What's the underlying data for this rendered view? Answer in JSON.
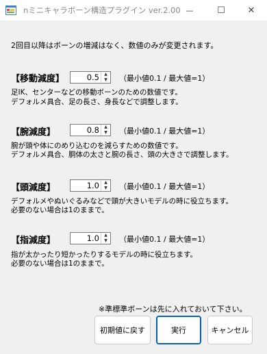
{
  "window": {
    "title": "nミニキャラボーン構造プラグイン ver.2.00",
    "minimize_glyph": "—",
    "maximize_glyph": "☐",
    "close_glyph": "✕"
  },
  "intro_text": "2回目以降はボーンの増減はなく、数値のみが変更されます。",
  "sections": [
    {
      "label": "【移動減度】",
      "value": "0.5",
      "range": "（最小値0.1 / 最大値=1）",
      "desc_line1": "足IK、センターなどの移動ボーンのための数値です。",
      "desc_line2": "デフォルメ具合、足の長さ、身長などで調整します。"
    },
    {
      "label": "【腕減度】",
      "value": "0.8",
      "range": "（最小値0.1 / 最大値=1）",
      "desc_line1": "腕が頭や体にのめり込むのを減らすための数値です。",
      "desc_line2": "デフォルメ具合、胴体の太さと腕の長さ、頭の大きさで調整します。"
    },
    {
      "label": "【頭減度】",
      "value": "1.0",
      "range": "（最小値0.1 / 最大値=1）",
      "desc_line1": "デフォルメやぬいぐるみなどで頭が大きいモデルの時に役立ちます。",
      "desc_line2": "必要のない場合は1のままで。"
    },
    {
      "label": "【指減度】",
      "value": "1.0",
      "range": "（最小値0.1 / 最大値=1）",
      "desc_line1": "指が太かったり短かったりするモデルの時に役立ちます。",
      "desc_line2": "必要のない場合は1のままで。"
    }
  ],
  "spin_up_glyph": "▲",
  "spin_down_glyph": "▼",
  "note": "※準標準ボーンは先に入れておいて下さい。",
  "buttons": {
    "reset": "初期値に戻す",
    "run": "実行",
    "cancel": "キャンセル"
  }
}
